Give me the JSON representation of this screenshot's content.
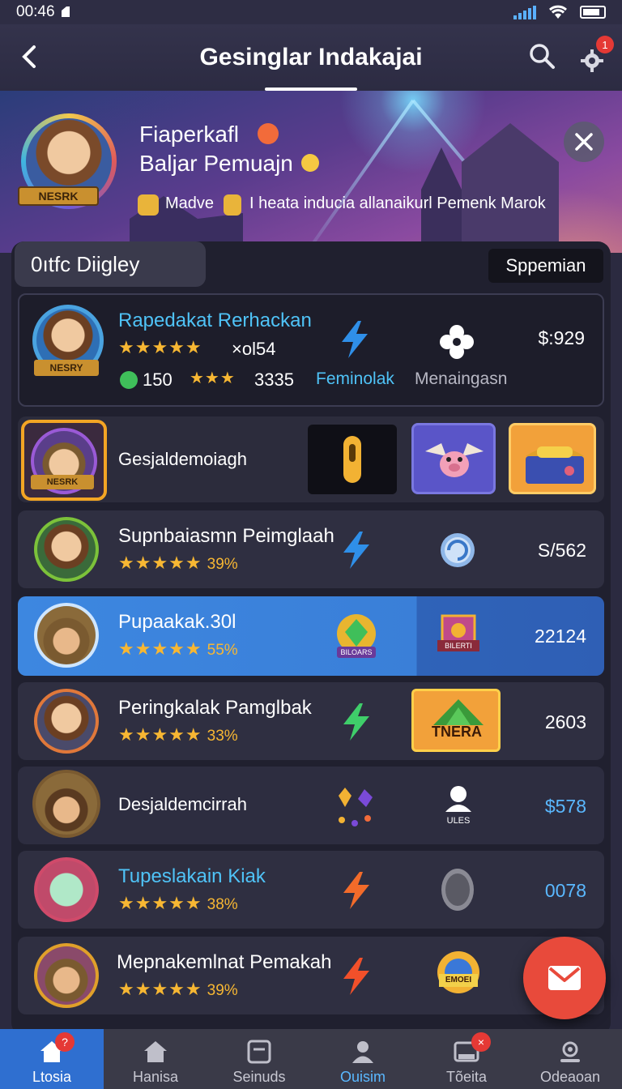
{
  "status_bar": {
    "time": "00:46"
  },
  "header": {
    "title": "Gesinglar Indakajai",
    "settings_badge": "1"
  },
  "hero": {
    "line1": "Fiaperkafl",
    "line2": "Baljar Pemuajn",
    "line3a": "Madve",
    "line3b": "I heata inducia allanaikurl Pemenk Marok",
    "avatar_banner": "NESRK"
  },
  "section": {
    "tab_label": "0ıtfc Diigley",
    "filter_label": "Sppemian"
  },
  "featured": {
    "name": "Rapedakat Rerhackan",
    "multiplier": "×ol54",
    "coins": "150",
    "score": "3335",
    "link_label": "Feminolak",
    "secondary_label": "Menaingasn",
    "value": "$:929",
    "avatar_banner": "NESRY"
  },
  "gift_row": {
    "label": "Gesjaldemoiagh",
    "avatar_banner": "NESRK"
  },
  "rows": [
    {
      "name": "Supnbaiasmn Peimglaah",
      "pct": "39%",
      "value": "S/562"
    },
    {
      "name": "Pupaakak.30l",
      "pct": "55%",
      "value": "22124",
      "badge": "BILOARS",
      "badge2": "BILERTI"
    },
    {
      "name": "Peringkalak Pamglbak",
      "pct": "33%",
      "value": "2603",
      "badge": "TNERA"
    },
    {
      "name": "Desjaldemcirrah",
      "pct": "",
      "value": "$578",
      "badge": "ULES"
    },
    {
      "name": "Tupeslakain Kiak",
      "pct": "38%",
      "value": "0078"
    },
    {
      "name": "Mepnakemlnat Pemakah",
      "pct": "39%",
      "value": "",
      "badge": "EMOEI"
    }
  ],
  "bottom_nav": [
    {
      "label": "Ltosia",
      "badge": "?"
    },
    {
      "label": "Hanisa"
    },
    {
      "label": "Seinuds"
    },
    {
      "label": "Ouisim"
    },
    {
      "label": "Tõeita",
      "badge": "×"
    },
    {
      "label": "Odeaoan"
    }
  ],
  "colors": {
    "accent": "#3d87e0",
    "star": "#f7b733",
    "fab": "#e84a3b",
    "link": "#4fc3f7"
  }
}
